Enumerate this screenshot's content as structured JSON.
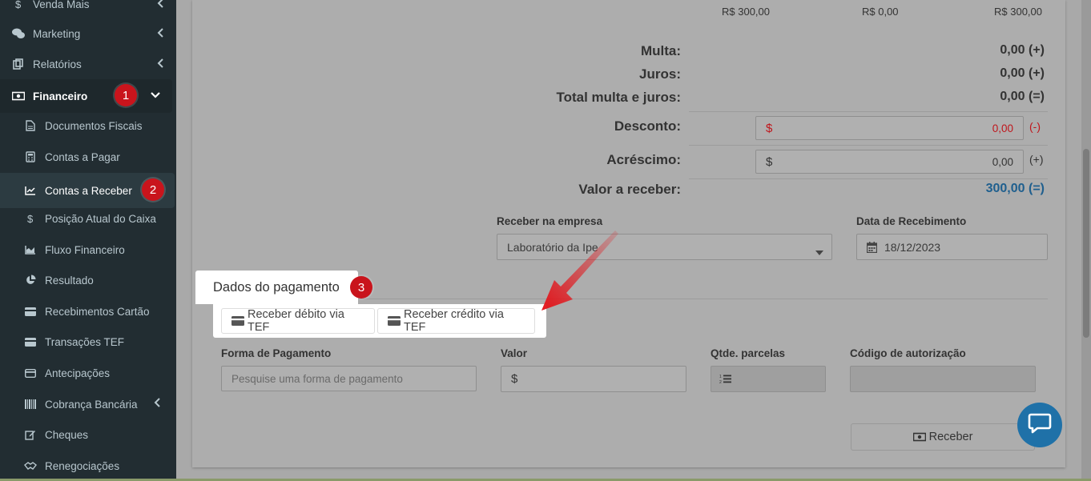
{
  "sidebar": {
    "items": [
      {
        "label": "Venda Mais",
        "icon": "dollar-icon"
      },
      {
        "label": "Marketing",
        "icon": "comments-icon"
      },
      {
        "label": "Relatórios",
        "icon": "copy-icon"
      },
      {
        "label": "Financeiro",
        "icon": "money-icon",
        "badge": "1"
      },
      {
        "label": "Documentos Fiscais",
        "icon": "file-icon"
      },
      {
        "label": "Contas a Pagar",
        "icon": "calculator-icon"
      },
      {
        "label": "Contas a Receber",
        "icon": "line-chart-icon",
        "badge": "2"
      },
      {
        "label": "Posição Atual do Caixa",
        "icon": "dollar-icon"
      },
      {
        "label": "Fluxo Financeiro",
        "icon": "area-chart-icon"
      },
      {
        "label": "Resultado",
        "icon": "pie-chart-icon"
      },
      {
        "label": "Recebimentos Cartão",
        "icon": "credit-card-icon"
      },
      {
        "label": "Transações TEF",
        "icon": "credit-card-icon"
      },
      {
        "label": "Antecipações",
        "icon": "card-outline-icon"
      },
      {
        "label": "Cobrança Bancária",
        "icon": "barcode-icon"
      },
      {
        "label": "Cheques",
        "icon": "edit-icon"
      },
      {
        "label": "Renegociações",
        "icon": "handshake-icon"
      }
    ]
  },
  "totals_row": {
    "a": "R$ 300,00",
    "b": "R$ 0,00",
    "c": "R$ 300,00"
  },
  "summary": {
    "multa_label": "Multa:",
    "multa_value": "0,00 (+)",
    "juros_label": "Juros:",
    "juros_value": "0,00 (+)",
    "total_label": "Total multa e juros:",
    "total_value": "0,00 (=)",
    "desconto_label": "Desconto:",
    "desconto_currency": "$",
    "desconto_value": "0,00",
    "desconto_sign": "(-)",
    "acrescimo_label": "Acréscimo:",
    "acrescimo_currency": "$",
    "acrescimo_value": "0,00",
    "acrescimo_sign": "(+)",
    "valor_label": "Valor a receber:",
    "valor_value": "300,00 (=)"
  },
  "empresa": {
    "label": "Receber na empresa",
    "value": "Laboratório da Ipe"
  },
  "data_recebimento": {
    "label": "Data de Recebimento",
    "value": "18/12/2023"
  },
  "pagamento": {
    "tab_label": "Dados do pagamento",
    "badge": "3",
    "debit_button": "Receber débito via TEF",
    "credit_button": "Receber crédito via TEF",
    "forma_label": "Forma de Pagamento",
    "forma_placeholder": "Pesquise uma forma de pagamento",
    "valor_label": "Valor",
    "valor_currency": "$",
    "parcelas_label": "Qtde. parcelas",
    "codigo_label": "Código de autorização",
    "receber_button": "Receber"
  },
  "colors": {
    "sidebar_bg": "#222d32",
    "badge": "#c9141c",
    "accent": "#1f71a8",
    "negative": "#c0151b",
    "arrow": "#e3141a"
  }
}
